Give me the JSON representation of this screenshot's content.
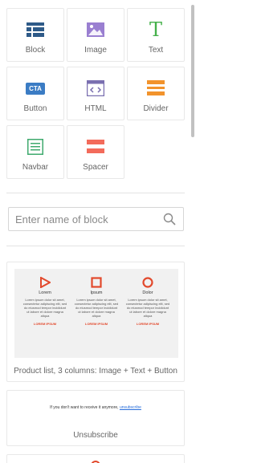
{
  "blocks": [
    {
      "label": "Block",
      "icon": "block-icon",
      "color": "#2e5a88"
    },
    {
      "label": "Image",
      "icon": "image-icon",
      "color": "#9a7fd1"
    },
    {
      "label": "Text",
      "icon": "text-icon",
      "color": "#44b04a",
      "glyph": "T"
    },
    {
      "label": "Button",
      "icon": "button-icon",
      "color": "#3b7cc4",
      "glyph": "CTA"
    },
    {
      "label": "HTML",
      "icon": "html-icon",
      "color": "#7a6fb0",
      "glyph": "<>"
    },
    {
      "label": "Divider",
      "icon": "divider-icon",
      "color": "#f2932c"
    },
    {
      "label": "Navbar",
      "icon": "navbar-icon",
      "color": "#3faa6e"
    },
    {
      "label": "Spacer",
      "icon": "spacer-icon",
      "color": "#f36b5b"
    }
  ],
  "search": {
    "placeholder": "Enter name of block",
    "icon": "search-icon"
  },
  "templates": [
    {
      "caption": "Product list, 3 columns: Image + Text + Button",
      "columns": [
        {
          "title": "Lorem",
          "icon": "play-icon",
          "text": "Lorem ipsum dolor sit amet, consectetur adipiscing elit, sed do eiusmod tempor incididunt ut labore et dolore magna aliqua",
          "link": "LOREM IPSUM"
        },
        {
          "title": "Ipsum",
          "icon": "square-icon",
          "text": "Lorem ipsum dolor sit amet, consectetur adipiscing elit, sed do eiusmod tempor incididunt ut labore et dolore magna aliqua",
          "link": "LOREM IPSUM"
        },
        {
          "title": "Dolor",
          "icon": "circle-icon",
          "text": "Lorem ipsum dolor sit amet, consectetur adipiscing elit, sed do eiusmod tempor incididunt ut labore et dolore magna aliqua",
          "link": "LOREM IPSUM"
        }
      ]
    },
    {
      "caption": "Unsubscribe",
      "line_text": "If you don't want to receive it anymore,",
      "line_link": "unsubscribe"
    }
  ],
  "colors": {
    "accent_red": "#e2492c",
    "link_blue": "#2a6fdb"
  }
}
